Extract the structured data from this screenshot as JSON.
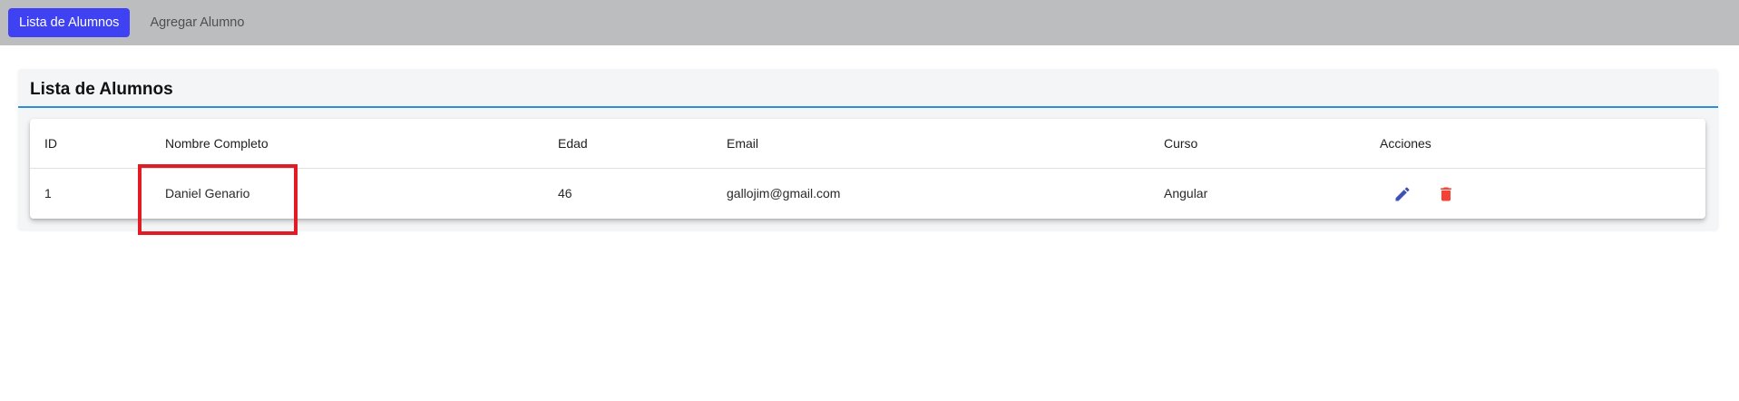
{
  "nav": {
    "items": [
      {
        "label": "Lista de Alumnos",
        "active": true
      },
      {
        "label": "Agregar Alumno",
        "active": false
      }
    ]
  },
  "card": {
    "title": "Lista de Alumnos"
  },
  "table": {
    "columns": [
      "ID",
      "Nombre Completo",
      "Edad",
      "Email",
      "Curso",
      "Acciones"
    ],
    "rows": [
      {
        "id": "1",
        "nombre": "Daniel Genario",
        "edad": "46",
        "email": "gallojim@gmail.com",
        "curso": "Angular"
      }
    ]
  },
  "icons": {
    "edit": "pencil-edit-icon",
    "delete": "trash-delete-icon"
  },
  "colors": {
    "nav_bg": "#bcbdbf",
    "active_button": "#3f42f2",
    "header_underline": "#2e8fd9",
    "edit_icon": "#3f51b5",
    "delete_icon": "#f44336",
    "highlight_box": "#e11c24"
  }
}
